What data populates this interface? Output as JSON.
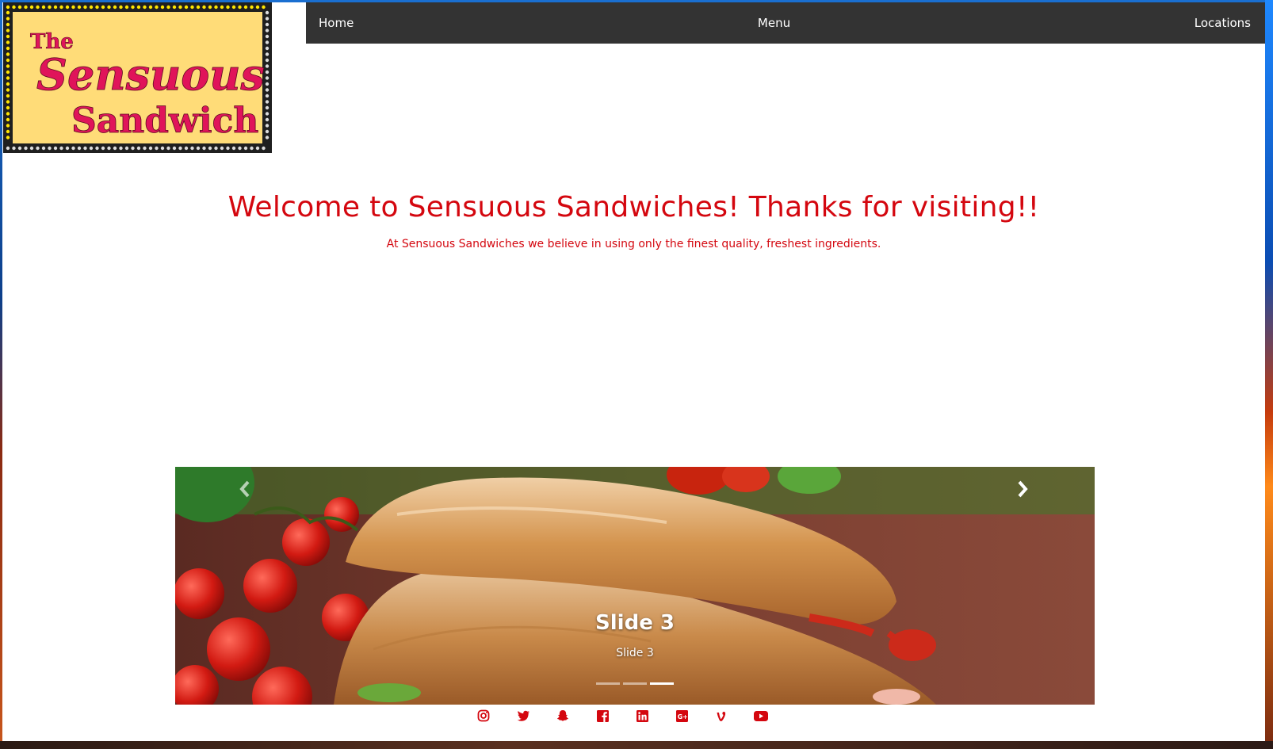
{
  "logo": {
    "line1": "The",
    "line2": "Sensuous",
    "line3": "Sandwich"
  },
  "nav": {
    "items": [
      {
        "label": "Home"
      },
      {
        "label": "Menu"
      },
      {
        "label": "Locations"
      }
    ]
  },
  "hero": {
    "title": "Welcome to Sensuous Sandwiches! Thanks for visiting!!",
    "subtitle": "At Sensuous Sandwiches we believe in using only the finest quality, freshest ingredients."
  },
  "carousel": {
    "slide_title": "Slide 3",
    "slide_text": "Slide 3",
    "slide_count": 3,
    "active_index": 2
  },
  "social": {
    "icons": [
      "instagram-icon",
      "twitter-icon",
      "snapchat-icon",
      "facebook-icon",
      "linkedin-icon",
      "google-plus-icon",
      "vine-icon",
      "youtube-icon"
    ]
  },
  "colors": {
    "accent": "#d4070f",
    "navbar": "#333333",
    "logo_bg": "#ffdc78",
    "logo_text": "#e0145a"
  }
}
